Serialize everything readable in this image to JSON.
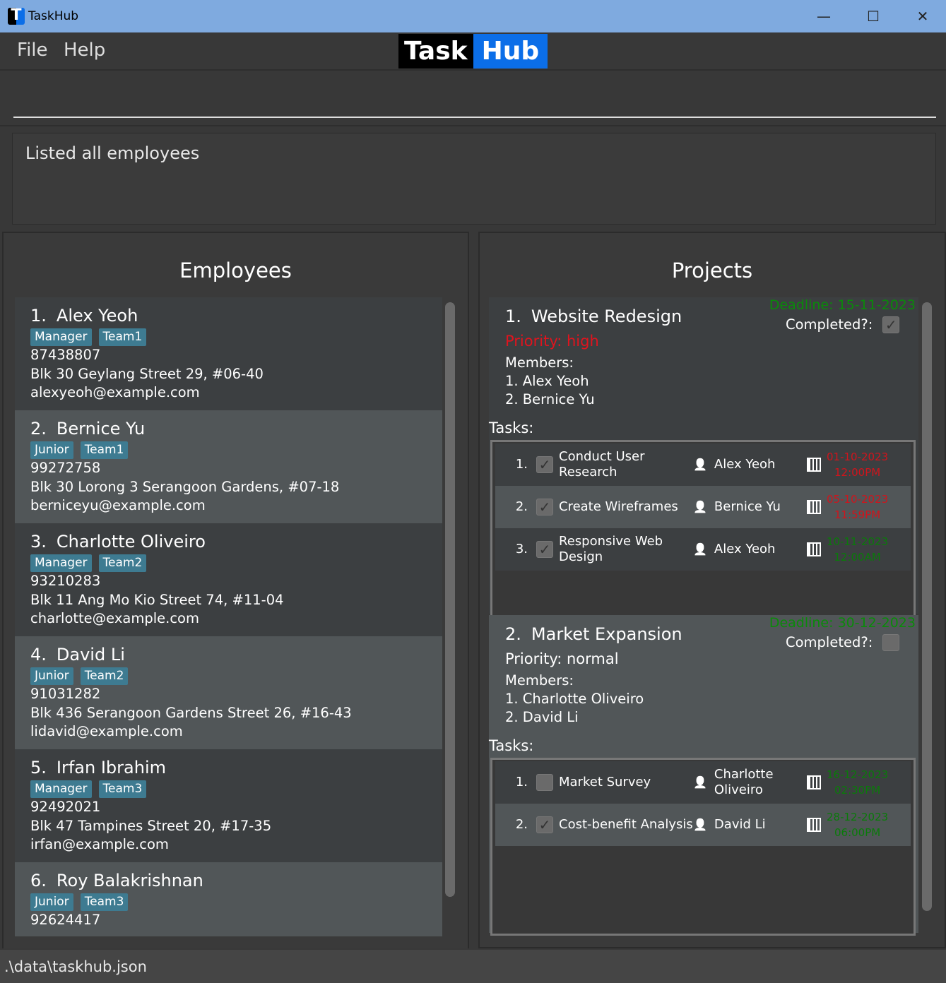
{
  "window": {
    "title": "TaskHub",
    "minimize": "—",
    "maximize": "☐",
    "close": "✕"
  },
  "menu": {
    "file": "File",
    "help": "Help"
  },
  "logo": {
    "part1": "Task",
    "part2": "Hub"
  },
  "command": {
    "value": "",
    "placeholder": ""
  },
  "result": {
    "message": "Listed all employees"
  },
  "employees": {
    "title": "Employees",
    "items": [
      {
        "index": "1.",
        "name": "Alex Yeoh",
        "tags": [
          "Manager",
          "Team1"
        ],
        "phone": "87438807",
        "address": "Blk 30 Geylang Street 29, #06-40",
        "email": "alexyeoh@example.com"
      },
      {
        "index": "2.",
        "name": "Bernice Yu",
        "tags": [
          "Junior",
          "Team1"
        ],
        "phone": "99272758",
        "address": "Blk 30 Lorong 3 Serangoon Gardens, #07-18",
        "email": "berniceyu@example.com"
      },
      {
        "index": "3.",
        "name": "Charlotte Oliveiro",
        "tags": [
          "Manager",
          "Team2"
        ],
        "phone": "93210283",
        "address": "Blk 11 Ang Mo Kio Street 74, #11-04",
        "email": "charlotte@example.com"
      },
      {
        "index": "4.",
        "name": "David Li",
        "tags": [
          "Junior",
          "Team2"
        ],
        "phone": "91031282",
        "address": "Blk 436 Serangoon Gardens Street 26, #16-43",
        "email": "lidavid@example.com"
      },
      {
        "index": "5.",
        "name": "Irfan Ibrahim",
        "tags": [
          "Manager",
          "Team3"
        ],
        "phone": "92492021",
        "address": "Blk 47 Tampines Street 20, #17-35",
        "email": "irfan@example.com"
      },
      {
        "index": "6.",
        "name": "Roy Balakrishnan",
        "tags": [
          "Junior",
          "Team3"
        ],
        "phone": "92624417",
        "address": "",
        "email": ""
      }
    ]
  },
  "projects": {
    "title": "Projects",
    "completed_label": "Completed?:",
    "members_label": "Members:",
    "tasks_label": "Tasks:",
    "items": [
      {
        "index": "1.",
        "name": "Website Redesign",
        "deadline": "Deadline: 15-11-2023",
        "priority": "Priority: high",
        "priority_color": "#e0141e",
        "completed": true,
        "members": [
          "1. Alex Yeoh",
          "2. Bernice Yu"
        ],
        "tasks": [
          {
            "index": "1.",
            "name": "Conduct User Research",
            "done": true,
            "assignee": "Alex Yeoh",
            "date": "01-10-2023",
            "time": "12:00PM",
            "color": "#d0141c"
          },
          {
            "index": "2.",
            "name": "Create Wireframes",
            "done": true,
            "assignee": "Bernice Yu",
            "date": "05-10-2023",
            "time": "11:59PM",
            "color": "#d0141c"
          },
          {
            "index": "3.",
            "name": "Responsive Web Design",
            "done": true,
            "assignee": "Alex Yeoh",
            "date": "10-11-2023",
            "time": "12:00AM",
            "color": "#0a7a0a"
          }
        ]
      },
      {
        "index": "2.",
        "name": "Market Expansion",
        "deadline": "Deadline: 30-12-2023",
        "priority": "Priority: normal",
        "priority_color": "#ffffff",
        "completed": false,
        "members": [
          "1. Charlotte Oliveiro",
          "2. David Li"
        ],
        "tasks": [
          {
            "index": "1.",
            "name": "Market Survey",
            "done": false,
            "assignee": "Charlotte Oliveiro",
            "date": "16-12-2023",
            "time": "02:30PM",
            "color": "#0a7a0a"
          },
          {
            "index": "2.",
            "name": "Cost-benefit Analysis",
            "done": true,
            "assignee": "David Li",
            "date": "28-12-2023",
            "time": "06:00PM",
            "color": "#0a7a0a"
          }
        ]
      }
    ]
  },
  "status": {
    "path": ".\\data\\taskhub.json"
  }
}
